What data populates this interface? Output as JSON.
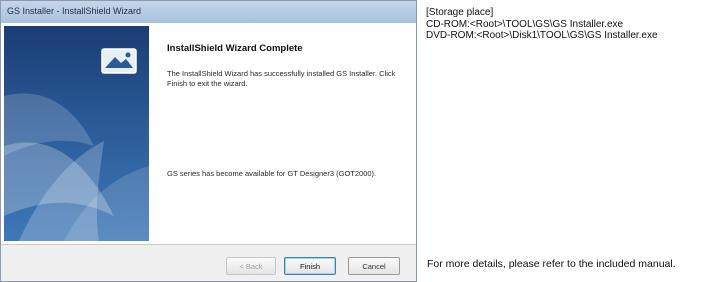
{
  "window": {
    "title": "GS Installer - InstallShield Wizard",
    "heading": "InstallShield Wizard Complete",
    "message": "The InstallShield Wizard has successfully installed GS Installer. Click Finish to exit the wizard.",
    "availability": "GS series has become available for GT Designer3 (GOT2000).",
    "buttons": {
      "back": "< Back",
      "finish": "Finish",
      "cancel": "Cancel"
    },
    "icons": {
      "brand": "installer-brand-icon"
    }
  },
  "notes": {
    "storage_label": "[Storage place]",
    "cd_rom_path": "CD-ROM:<Root>\\TOOL\\GS\\GS Installer.exe",
    "dvd_rom_path": "DVD-ROM:<Root>\\Disk1\\TOOL\\GS\\GS Installer.exe",
    "more_details": "For more details, please refer to the included manual."
  },
  "colors": {
    "side_panel_top": "#1a3d73",
    "side_panel_bottom": "#3f78b8",
    "title_bar": "#b6cce3"
  }
}
